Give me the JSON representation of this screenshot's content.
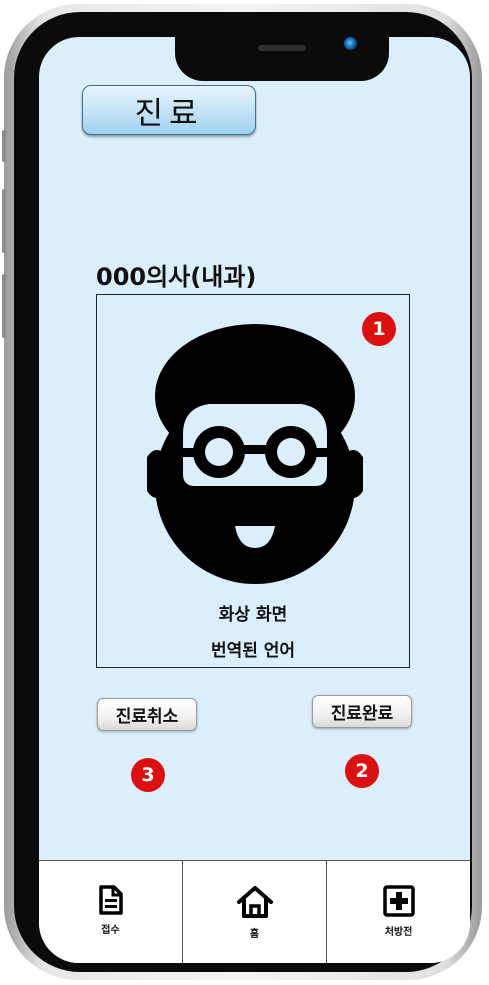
{
  "header": {
    "title": "진료"
  },
  "doctor": {
    "name": "000의사(내과)"
  },
  "video": {
    "caption_line1": "화상 화면",
    "caption_line2": "번역된 언어",
    "badge": "1"
  },
  "actions": {
    "cancel_label": "진료취소",
    "complete_label": "진료완료",
    "cancel_badge": "3",
    "complete_badge": "2"
  },
  "nav": {
    "items": [
      {
        "label": "접수",
        "icon": "document-icon"
      },
      {
        "label": "홈",
        "icon": "home-icon"
      },
      {
        "label": "처방전",
        "icon": "plus-box-icon"
      }
    ]
  },
  "colors": {
    "screen_bg": "#dbeefb",
    "badge": "#dd1010",
    "title_border": "#3a6f96"
  }
}
